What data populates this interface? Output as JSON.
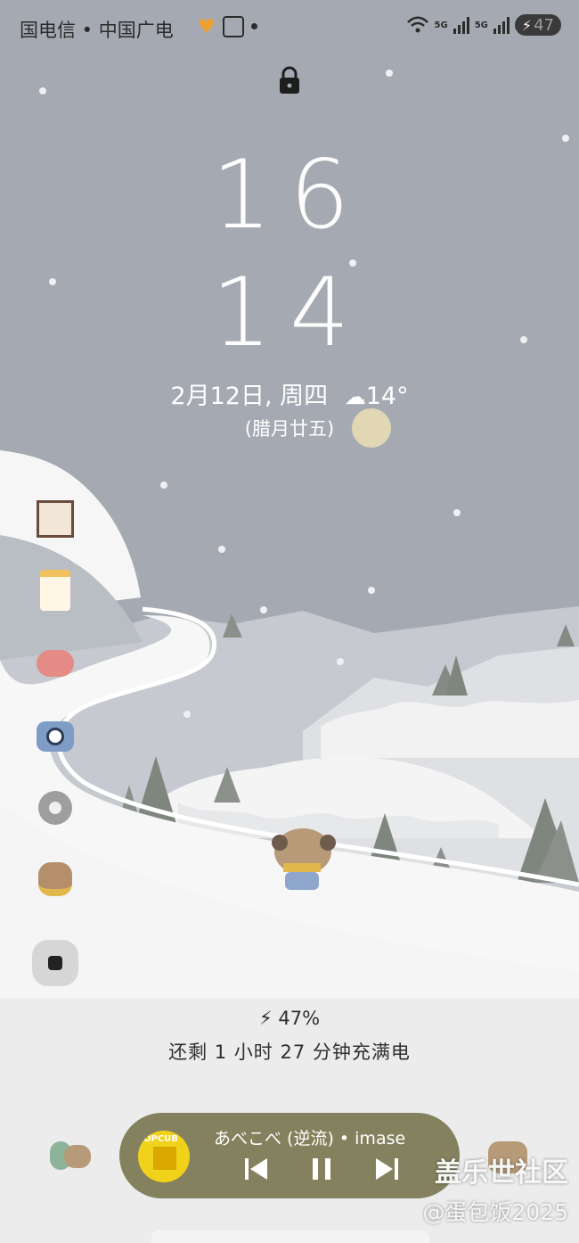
{
  "status_bar": {
    "carrier_text": "国电信  •  中国广电",
    "signal_1": "5G",
    "signal_2": "5G",
    "battery": "47"
  },
  "lock_screen": {
    "clock_hour": "16",
    "clock_minute": "14",
    "date_weather": "2月12日, 周四",
    "temperature": "14°",
    "lunar_date": "(腊月廿五)"
  },
  "charging": {
    "percent": "47%",
    "message": "还剩 1 小时 27 分钟充满电"
  },
  "music_player": {
    "title": "あべこべ (逆流)  •  imase",
    "album_label": "OPCUB",
    "accent_color": "#84825e"
  },
  "watermark": {
    "line1": "盖乐世社区",
    "line2": "@蛋包饭2025"
  },
  "colors": {
    "sky": "#a5aab2",
    "snow": "#f7f7f7",
    "sun": "#e2d7b4",
    "tree": "#7f867e"
  }
}
